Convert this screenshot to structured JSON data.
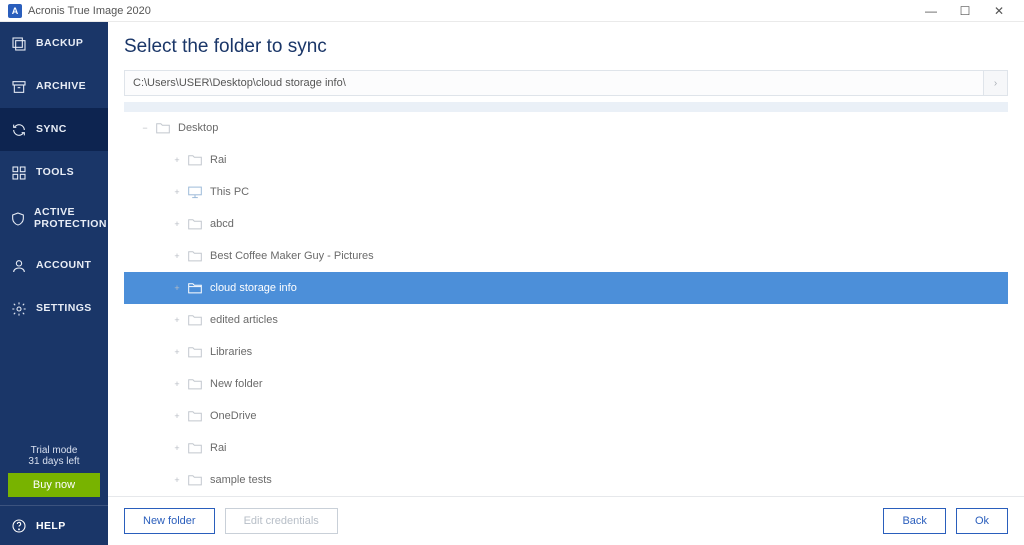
{
  "titlebar": {
    "app_name": "Acronis True Image 2020"
  },
  "sidebar": {
    "items": [
      {
        "label": "BACKUP"
      },
      {
        "label": "ARCHIVE"
      },
      {
        "label": "SYNC"
      },
      {
        "label": "TOOLS"
      },
      {
        "label": "ACTIVE PROTECTION"
      },
      {
        "label": "ACCOUNT"
      },
      {
        "label": "SETTINGS"
      }
    ],
    "trial_line1": "Trial mode",
    "trial_line2": "31 days left",
    "buy_label": "Buy now",
    "help_label": "HELP"
  },
  "main": {
    "title": "Select the folder to sync",
    "path_value": "C:\\Users\\USER\\Desktop\\cloud storage info\\",
    "root_label": "Desktop",
    "folders": [
      {
        "name": "Rai"
      },
      {
        "name": "This PC"
      },
      {
        "name": "abcd"
      },
      {
        "name": "Best Coffee Maker Guy - Pictures"
      },
      {
        "name": "cloud storage info"
      },
      {
        "name": "edited articles"
      },
      {
        "name": "Libraries"
      },
      {
        "name": "New folder"
      },
      {
        "name": "OneDrive"
      },
      {
        "name": "Rai"
      },
      {
        "name": "sample tests"
      }
    ],
    "selected_index": 4
  },
  "footer": {
    "new_folder": "New folder",
    "edit_credentials": "Edit credentials",
    "back": "Back",
    "ok": "Ok"
  }
}
